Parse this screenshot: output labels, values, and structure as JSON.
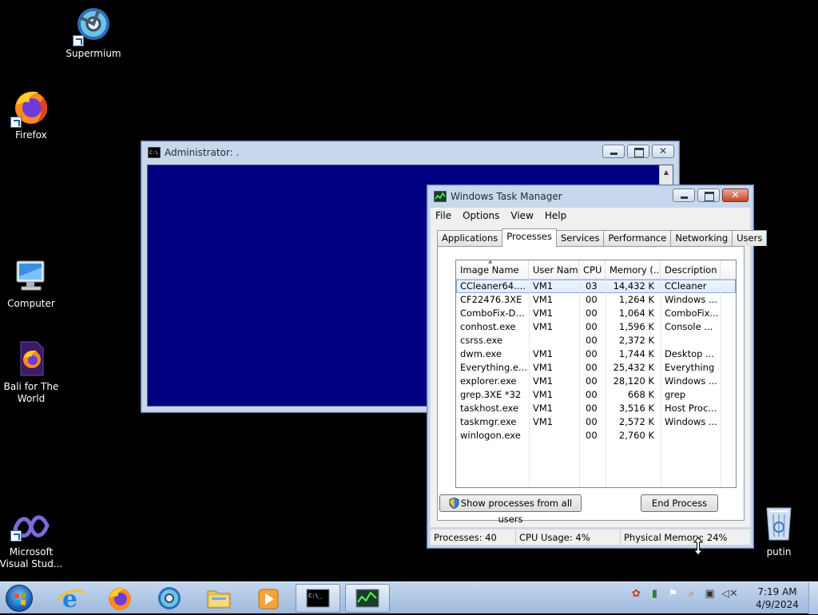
{
  "desktop": {
    "icons": [
      {
        "label": "Supermium",
        "icon": "supermium-icon"
      },
      {
        "label": "Firefox",
        "icon": "firefox-icon"
      },
      {
        "label": "Computer",
        "icon": "computer-icon"
      },
      {
        "label": "Bali for The World",
        "icon": "firefox-document-icon"
      },
      {
        "label": "Microsoft Visual Stud...",
        "icon": "visual-studio-icon"
      },
      {
        "label": "putin",
        "icon": "recycle-bin-icon"
      }
    ]
  },
  "cmd_window": {
    "title": "Administrator:  .",
    "icon": "console-icon",
    "background_color": "#000080"
  },
  "task_manager": {
    "title": "Windows Task Manager",
    "menu": [
      "File",
      "Options",
      "View",
      "Help"
    ],
    "tabs": [
      "Applications",
      "Processes",
      "Services",
      "Performance",
      "Networking",
      "Users"
    ],
    "active_tab": "Processes",
    "columns": [
      "Image Name",
      "User Name",
      "CPU",
      "Memory (...",
      "Description"
    ],
    "rows": [
      {
        "image": "CCleaner64.exe",
        "user": "VM1",
        "cpu": "03",
        "mem": "14,432 K",
        "desc": "CCleaner"
      },
      {
        "image": "CF22476.3XE",
        "user": "VM1",
        "cpu": "00",
        "mem": "1,264 K",
        "desc": "Windows ..."
      },
      {
        "image": "ComboFix-Do...",
        "user": "VM1",
        "cpu": "00",
        "mem": "1,064 K",
        "desc": "ComboFix..."
      },
      {
        "image": "conhost.exe",
        "user": "VM1",
        "cpu": "00",
        "mem": "1,596 K",
        "desc": "Console ..."
      },
      {
        "image": "csrss.exe",
        "user": "",
        "cpu": "00",
        "mem": "2,372 K",
        "desc": ""
      },
      {
        "image": "dwm.exe",
        "user": "VM1",
        "cpu": "00",
        "mem": "1,744 K",
        "desc": "Desktop ..."
      },
      {
        "image": "Everything.exe",
        "user": "VM1",
        "cpu": "00",
        "mem": "25,432 K",
        "desc": "Everything"
      },
      {
        "image": "explorer.exe",
        "user": "VM1",
        "cpu": "00",
        "mem": "28,120 K",
        "desc": "Windows ..."
      },
      {
        "image": "grep.3XE *32",
        "user": "VM1",
        "cpu": "00",
        "mem": "668 K",
        "desc": "grep"
      },
      {
        "image": "taskhost.exe",
        "user": "VM1",
        "cpu": "00",
        "mem": "3,516 K",
        "desc": "Host Proc..."
      },
      {
        "image": "taskmgr.exe",
        "user": "VM1",
        "cpu": "00",
        "mem": "2,572 K",
        "desc": "Windows ..."
      },
      {
        "image": "winlogon.exe",
        "user": "",
        "cpu": "00",
        "mem": "2,760 K",
        "desc": ""
      }
    ],
    "selected_row": 0,
    "show_all_button": "Show processes from all users",
    "end_process_button": "End Process",
    "status": {
      "processes": "Processes: 40",
      "cpu": "CPU Usage: 4%",
      "memory": "Physical Memory: 24%"
    }
  },
  "taskbar": {
    "pinned": [
      {
        "name": "internet-explorer-icon"
      },
      {
        "name": "firefox-icon"
      },
      {
        "name": "supermium-icon"
      },
      {
        "name": "file-explorer-icon"
      },
      {
        "name": "media-player-icon"
      },
      {
        "name": "cmd-icon",
        "active": true
      },
      {
        "name": "task-manager-icon",
        "active": true
      }
    ],
    "clock": {
      "time": "7:19 AM",
      "date": "4/9/2024"
    }
  }
}
